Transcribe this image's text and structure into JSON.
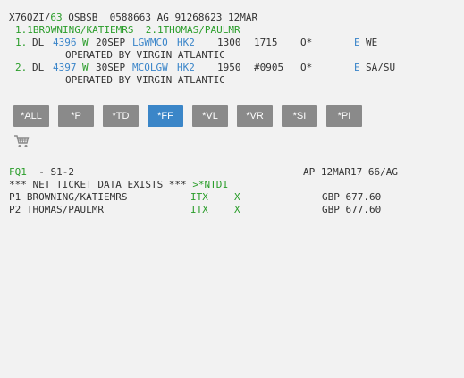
{
  "pnr": {
    "header": {
      "record": "X76QZI/",
      "agent": "63",
      "rest": " QSBSB  0588663 AG 91268623 12MAR"
    },
    "names": "1.1BROWNING/KATIEMRS  2.1THOMAS/PAULMR",
    "segments": [
      {
        "num": "1.",
        "airline": "DL",
        "flight": "4396",
        "class": "W",
        "date": "20SEP",
        "route": "LGWMCO",
        "status": "HK2",
        "dep": "1300",
        "arr": "1715",
        "flag": "O*",
        "eticket": "E",
        "days": "WE",
        "operated": "OPERATED BY VIRGIN ATLANTIC"
      },
      {
        "num": "2.",
        "airline": "DL",
        "flight": "4397",
        "class": "W",
        "date": "30SEP",
        "route": "MCOLGW",
        "status": "HK2",
        "dep": "1950",
        "arr": "#0905",
        "flag": "O*",
        "eticket": "E",
        "days": "SA/SU",
        "operated": "OPERATED BY VIRGIN ATLANTIC"
      }
    ]
  },
  "buttons": [
    "*ALL",
    "*P",
    "*TD",
    "*FF",
    "*VL",
    "*VR",
    "*SI",
    "*PI"
  ],
  "active_button": "*FF",
  "cart_icon": "shopping-cart-icon",
  "fare": {
    "fq": "FQ1",
    "segs": "  - S1-2",
    "ap": "AP 12MAR17 66/AG",
    "net_notice": "*** NET TICKET DATA EXISTS *** ",
    "net_link": ">*NTD1",
    "passengers": [
      {
        "label": "P1 BROWNING/KATIEMRS",
        "type": "ITX",
        "flag": "X",
        "amount": "GBP 677.60"
      },
      {
        "label": "P2 THOMAS/PAULMR",
        "type": "ITX",
        "flag": "X",
        "amount": "GBP 677.60"
      }
    ]
  },
  "colors": {
    "green": "#2a9d2a",
    "blue": "#3a85c9",
    "button_bg": "#8a8a8a",
    "button_active_bg": "#3b86c8",
    "page_bg": "#f2f2f2"
  }
}
